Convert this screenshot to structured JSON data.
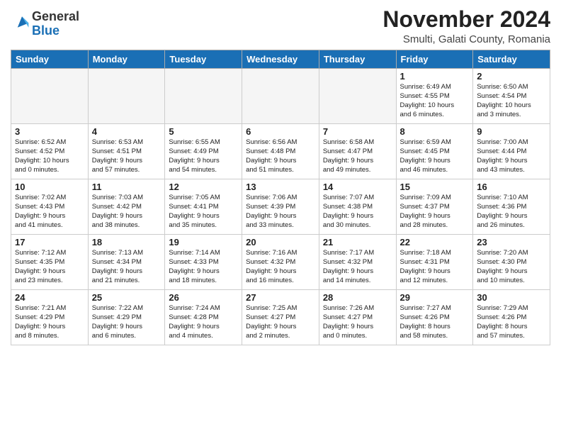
{
  "logo": {
    "general": "General",
    "blue": "Blue"
  },
  "title": "November 2024",
  "location": "Smulti, Galati County, Romania",
  "days": [
    "Sunday",
    "Monday",
    "Tuesday",
    "Wednesday",
    "Thursday",
    "Friday",
    "Saturday"
  ],
  "cells": [
    {
      "day": "",
      "info": ""
    },
    {
      "day": "",
      "info": ""
    },
    {
      "day": "",
      "info": ""
    },
    {
      "day": "",
      "info": ""
    },
    {
      "day": "",
      "info": ""
    },
    {
      "day": "1",
      "info": "Sunrise: 6:49 AM\nSunset: 4:55 PM\nDaylight: 10 hours\nand 6 minutes."
    },
    {
      "day": "2",
      "info": "Sunrise: 6:50 AM\nSunset: 4:54 PM\nDaylight: 10 hours\nand 3 minutes."
    },
    {
      "day": "3",
      "info": "Sunrise: 6:52 AM\nSunset: 4:52 PM\nDaylight: 10 hours\nand 0 minutes."
    },
    {
      "day": "4",
      "info": "Sunrise: 6:53 AM\nSunset: 4:51 PM\nDaylight: 9 hours\nand 57 minutes."
    },
    {
      "day": "5",
      "info": "Sunrise: 6:55 AM\nSunset: 4:49 PM\nDaylight: 9 hours\nand 54 minutes."
    },
    {
      "day": "6",
      "info": "Sunrise: 6:56 AM\nSunset: 4:48 PM\nDaylight: 9 hours\nand 51 minutes."
    },
    {
      "day": "7",
      "info": "Sunrise: 6:58 AM\nSunset: 4:47 PM\nDaylight: 9 hours\nand 49 minutes."
    },
    {
      "day": "8",
      "info": "Sunrise: 6:59 AM\nSunset: 4:45 PM\nDaylight: 9 hours\nand 46 minutes."
    },
    {
      "day": "9",
      "info": "Sunrise: 7:00 AM\nSunset: 4:44 PM\nDaylight: 9 hours\nand 43 minutes."
    },
    {
      "day": "10",
      "info": "Sunrise: 7:02 AM\nSunset: 4:43 PM\nDaylight: 9 hours\nand 41 minutes."
    },
    {
      "day": "11",
      "info": "Sunrise: 7:03 AM\nSunset: 4:42 PM\nDaylight: 9 hours\nand 38 minutes."
    },
    {
      "day": "12",
      "info": "Sunrise: 7:05 AM\nSunset: 4:41 PM\nDaylight: 9 hours\nand 35 minutes."
    },
    {
      "day": "13",
      "info": "Sunrise: 7:06 AM\nSunset: 4:39 PM\nDaylight: 9 hours\nand 33 minutes."
    },
    {
      "day": "14",
      "info": "Sunrise: 7:07 AM\nSunset: 4:38 PM\nDaylight: 9 hours\nand 30 minutes."
    },
    {
      "day": "15",
      "info": "Sunrise: 7:09 AM\nSunset: 4:37 PM\nDaylight: 9 hours\nand 28 minutes."
    },
    {
      "day": "16",
      "info": "Sunrise: 7:10 AM\nSunset: 4:36 PM\nDaylight: 9 hours\nand 26 minutes."
    },
    {
      "day": "17",
      "info": "Sunrise: 7:12 AM\nSunset: 4:35 PM\nDaylight: 9 hours\nand 23 minutes."
    },
    {
      "day": "18",
      "info": "Sunrise: 7:13 AM\nSunset: 4:34 PM\nDaylight: 9 hours\nand 21 minutes."
    },
    {
      "day": "19",
      "info": "Sunrise: 7:14 AM\nSunset: 4:33 PM\nDaylight: 9 hours\nand 18 minutes."
    },
    {
      "day": "20",
      "info": "Sunrise: 7:16 AM\nSunset: 4:32 PM\nDaylight: 9 hours\nand 16 minutes."
    },
    {
      "day": "21",
      "info": "Sunrise: 7:17 AM\nSunset: 4:32 PM\nDaylight: 9 hours\nand 14 minutes."
    },
    {
      "day": "22",
      "info": "Sunrise: 7:18 AM\nSunset: 4:31 PM\nDaylight: 9 hours\nand 12 minutes."
    },
    {
      "day": "23",
      "info": "Sunrise: 7:20 AM\nSunset: 4:30 PM\nDaylight: 9 hours\nand 10 minutes."
    },
    {
      "day": "24",
      "info": "Sunrise: 7:21 AM\nSunset: 4:29 PM\nDaylight: 9 hours\nand 8 minutes."
    },
    {
      "day": "25",
      "info": "Sunrise: 7:22 AM\nSunset: 4:29 PM\nDaylight: 9 hours\nand 6 minutes."
    },
    {
      "day": "26",
      "info": "Sunrise: 7:24 AM\nSunset: 4:28 PM\nDaylight: 9 hours\nand 4 minutes."
    },
    {
      "day": "27",
      "info": "Sunrise: 7:25 AM\nSunset: 4:27 PM\nDaylight: 9 hours\nand 2 minutes."
    },
    {
      "day": "28",
      "info": "Sunrise: 7:26 AM\nSunset: 4:27 PM\nDaylight: 9 hours\nand 0 minutes."
    },
    {
      "day": "29",
      "info": "Sunrise: 7:27 AM\nSunset: 4:26 PM\nDaylight: 8 hours\nand 58 minutes."
    },
    {
      "day": "30",
      "info": "Sunrise: 7:29 AM\nSunset: 4:26 PM\nDaylight: 8 hours\nand 57 minutes."
    }
  ]
}
